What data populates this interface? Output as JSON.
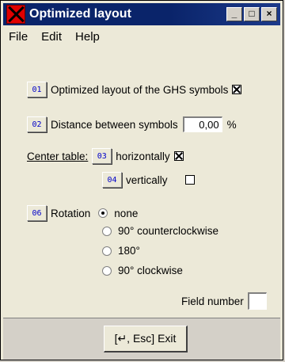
{
  "window": {
    "title": "Optimized layout",
    "controls": {
      "minimize": "_",
      "maximize": "□",
      "close": "×"
    }
  },
  "menu": [
    "File",
    "Edit",
    "Help"
  ],
  "options": {
    "opt1": {
      "num": "01",
      "label": "Optimized layout of the GHS symbols",
      "checked": true
    },
    "opt2": {
      "num": "02",
      "label": "Distance between symbols",
      "value": "0,00",
      "unit": "%"
    },
    "center": {
      "label": "Center table:",
      "h": {
        "num": "03",
        "label": "horizontally",
        "checked": true
      },
      "v": {
        "num": "04",
        "label": "vertically",
        "checked": false
      }
    },
    "rotation": {
      "num": "06",
      "label": "Rotation",
      "choices": [
        "none",
        "90° counterclockwise",
        "180°",
        "90° clockwise"
      ],
      "selected": "none"
    },
    "field_number": {
      "label": "Field number",
      "value": ""
    }
  },
  "footer": {
    "exit_label": "[↵, Esc] Exit"
  }
}
